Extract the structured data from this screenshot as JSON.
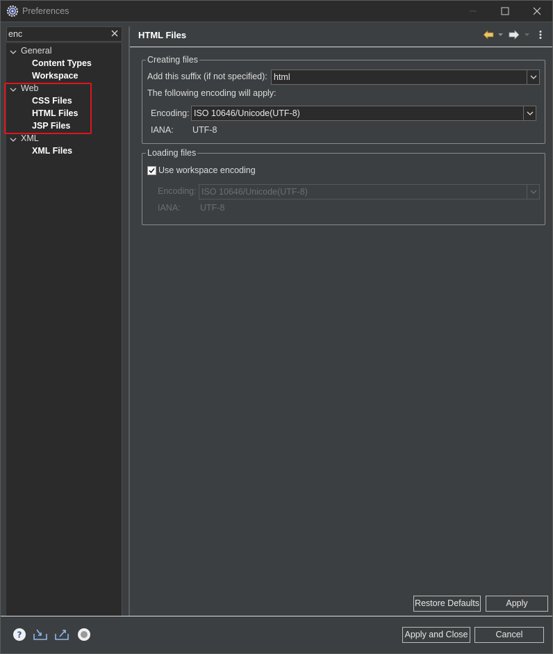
{
  "window": {
    "title": "Preferences"
  },
  "filter": {
    "value": "enc"
  },
  "tree": {
    "general": {
      "label": "General",
      "children": [
        "Content Types",
        "Workspace"
      ]
    },
    "web": {
      "label": "Web",
      "children": [
        "CSS Files",
        "HTML Files",
        "JSP Files"
      ]
    },
    "xml": {
      "label": "XML",
      "children": [
        "XML Files"
      ]
    }
  },
  "page": {
    "title": "HTML Files"
  },
  "creating": {
    "group_title": "Creating files",
    "suffix_label": "Add this suffix (if not specified):",
    "suffix_value": "html",
    "encoding_note": "The following encoding will apply:",
    "encoding_label": "Encoding:",
    "encoding_value": "ISO 10646/Unicode(UTF-8)",
    "iana_label": "IANA:",
    "iana_value": "UTF-8"
  },
  "loading": {
    "group_title": "Loading files",
    "checkbox_label": "Use workspace encoding",
    "checkbox_checked": true,
    "encoding_label": "Encoding:",
    "encoding_value": "ISO 10646/Unicode(UTF-8)",
    "iana_label": "IANA:",
    "iana_value": "UTF-8"
  },
  "buttons": {
    "restore_defaults": "Restore Defaults",
    "apply": "Apply",
    "apply_close": "Apply and Close",
    "cancel": "Cancel"
  },
  "colors": {
    "background": "#3c3f41",
    "panel": "#2b2b2b",
    "highlight": "#e0141c",
    "back_arrow": "#e8c46a"
  },
  "icons": {
    "window": "gear-icon",
    "nav_back": "arrow-left-icon",
    "nav_forward": "arrow-right-icon",
    "view_menu": "kebab-menu-icon",
    "help": "help-icon",
    "import": "import-icon",
    "export": "export-icon",
    "oomph": "record-icon"
  }
}
